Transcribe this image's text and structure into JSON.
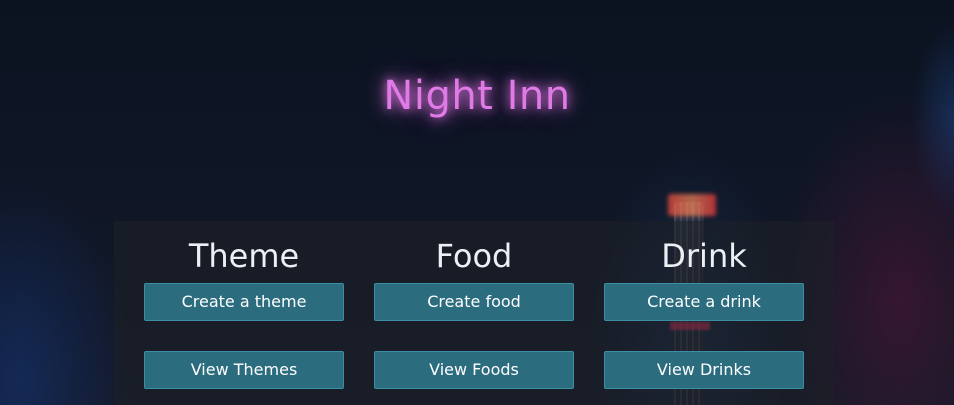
{
  "header": {
    "title": "Night Inn"
  },
  "sections": [
    {
      "heading": "Theme",
      "create_label": "Create a theme",
      "view_label": "View Themes"
    },
    {
      "heading": "Food",
      "create_label": "Create food",
      "view_label": "View Foods"
    },
    {
      "heading": "Drink",
      "create_label": "Create a drink",
      "view_label": "View Drinks"
    }
  ],
  "colors": {
    "title_glow": "#e07ae6",
    "button_bg": "#2b6c7f",
    "panel_bg": "#1e2126"
  }
}
